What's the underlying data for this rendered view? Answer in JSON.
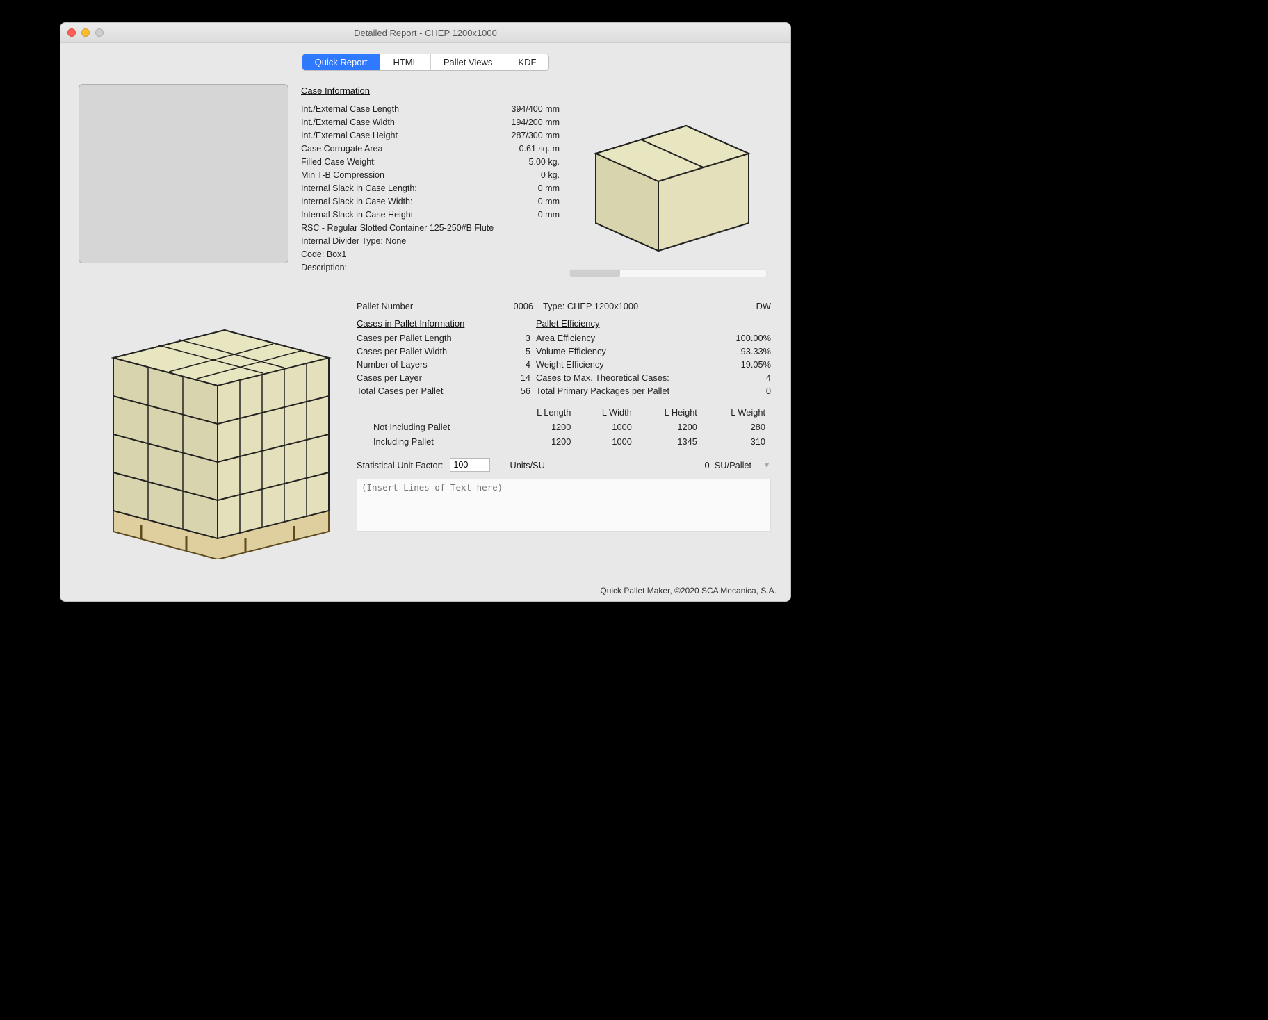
{
  "window": {
    "title": "Detailed Report - CHEP 1200x1000"
  },
  "tabs": {
    "quick_report": "Quick Report",
    "html": "HTML",
    "pallet_views": "Pallet Views",
    "kdf": "KDF"
  },
  "case_info": {
    "header": "Case Information",
    "int_ext_length_lbl": "Int./External Case Length",
    "int_ext_length_val": "394/400 mm",
    "int_ext_width_lbl": "Int./External Case Width",
    "int_ext_width_val": "194/200 mm",
    "int_ext_height_lbl": "Int./External Case Height",
    "int_ext_height_val": "287/300 mm",
    "corrugate_lbl": "Case Corrugate Area",
    "corrugate_val": "0.61 sq. m",
    "filled_weight_lbl": "Filled Case Weight:",
    "filled_weight_val": "5.00 kg.",
    "min_tb_lbl": "Min T-B Compression",
    "min_tb_val": "0 kg.",
    "slack_len_lbl": "Internal Slack in Case Length:",
    "slack_len_val": "0 mm",
    "slack_wid_lbl": "Internal Slack in Case Width:",
    "slack_wid_val": "0 mm",
    "slack_hgt_lbl": "Internal Slack in Case Height",
    "slack_hgt_val": "0 mm",
    "container_line": "RSC - Regular Slotted Container 125-250#B Flute",
    "divider_line": "Internal Divider Type: None",
    "code_line": "Code: Box1",
    "description_line": "Description:"
  },
  "pallet": {
    "number_lbl": "Pallet Number",
    "number_val": "0006",
    "type_line": "Type: CHEP 1200x1000",
    "dw": "DW"
  },
  "cases_in_pallet": {
    "header": "Cases in Pallet Information",
    "per_len_lbl": "Cases per Pallet Length",
    "per_len_val": "3",
    "per_wid_lbl": "Cases per Pallet Width",
    "per_wid_val": "5",
    "layers_lbl": "Number of Layers",
    "layers_val": "4",
    "per_layer_lbl": "Cases per Layer",
    "per_layer_val": "14",
    "total_lbl": "Total Cases per Pallet",
    "total_val": "56"
  },
  "efficiency": {
    "header": "Pallet Efficiency",
    "area_lbl": "Area Efficiency",
    "area_val": "100.00%",
    "vol_lbl": "Volume Efficiency",
    "vol_val": "93.33%",
    "wgt_lbl": "Weight Efficiency",
    "wgt_val": "19.05%",
    "max_lbl": "Cases to Max. Theoretical Cases:",
    "max_val": "4",
    "prim_lbl": "Total Primary Packages per Pallet",
    "prim_val": "0"
  },
  "dims": {
    "h_len": "L Length",
    "h_wid": "L Width",
    "h_hgt": "L Height",
    "h_wgt": "L Weight",
    "row1_lbl": "Not Including Pallet",
    "row1": {
      "len": "1200",
      "wid": "1000",
      "hgt": "1200",
      "wgt": "280"
    },
    "row2_lbl": "Including Pallet",
    "row2": {
      "len": "1200",
      "wid": "1000",
      "hgt": "1345",
      "wgt": "310"
    }
  },
  "stat": {
    "label": "Statistical Unit Factor:",
    "value": "100",
    "units_label": "Units/SU",
    "su_value": "0",
    "su_label": "SU/Pallet"
  },
  "notes_placeholder": "(Insert Lines of Text here)",
  "footer": "Quick Pallet Maker, ©2020 SCA Mecanica, S.A."
}
